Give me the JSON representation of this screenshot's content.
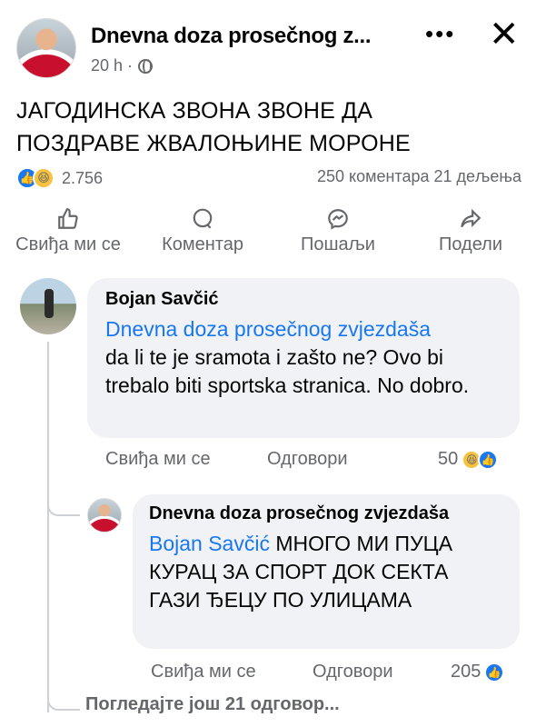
{
  "post": {
    "page_name": "Dnevna doza prosečnog z...",
    "time": "20 h ·",
    "more_label": "•••",
    "close_label": "✕",
    "text_line1": "ЈАГОДИНСКА ЗВОНА ЗВОНЕ ДА",
    "text_line2": "ПОЗДРАВЕ ЖВАЛОЊИНЕ МОРОНЕ",
    "reaction_count": "2.756",
    "comments_shares": "250 коментара  21 дељења"
  },
  "actions": {
    "like": "Свиђа ми се",
    "comment": "Коментар",
    "send": "Пошаљи",
    "share": "Подели"
  },
  "comments": [
    {
      "author": "Bojan Savčić",
      "mention": "Dnevna doza prosečnog zvjezdaša",
      "text": "da li te je sramota i zašto ne? Ovo bi trebalo biti sportska stranica. No dobro.",
      "like_label": "Свиђа ми се",
      "reply_label": "Одговори",
      "reaction_count": "50"
    },
    {
      "author": "Dnevna doza prosečnog zvjezdaša",
      "mention": "Bojan Savčić",
      "text": " МНОГО МИ ПУЦА КУРАЦ ЗА СПОРТ ДОК СЕКТА ГАЗИ ЂЕЦУ ПО УЛИЦАМА",
      "like_label": "Свиђа ми се",
      "reply_label": "Одговори",
      "reaction_count": "205"
    }
  ],
  "more_replies": "Погледајте још 21 одговор...",
  "colors": {
    "accent": "#1877f2",
    "muted": "#65676b",
    "bubble": "#f0f2f5",
    "haha": "#f7c33f"
  },
  "icons": [
    "globe-icon",
    "like-icon",
    "haha-icon",
    "comment-icon",
    "messenger-icon",
    "share-icon"
  ]
}
